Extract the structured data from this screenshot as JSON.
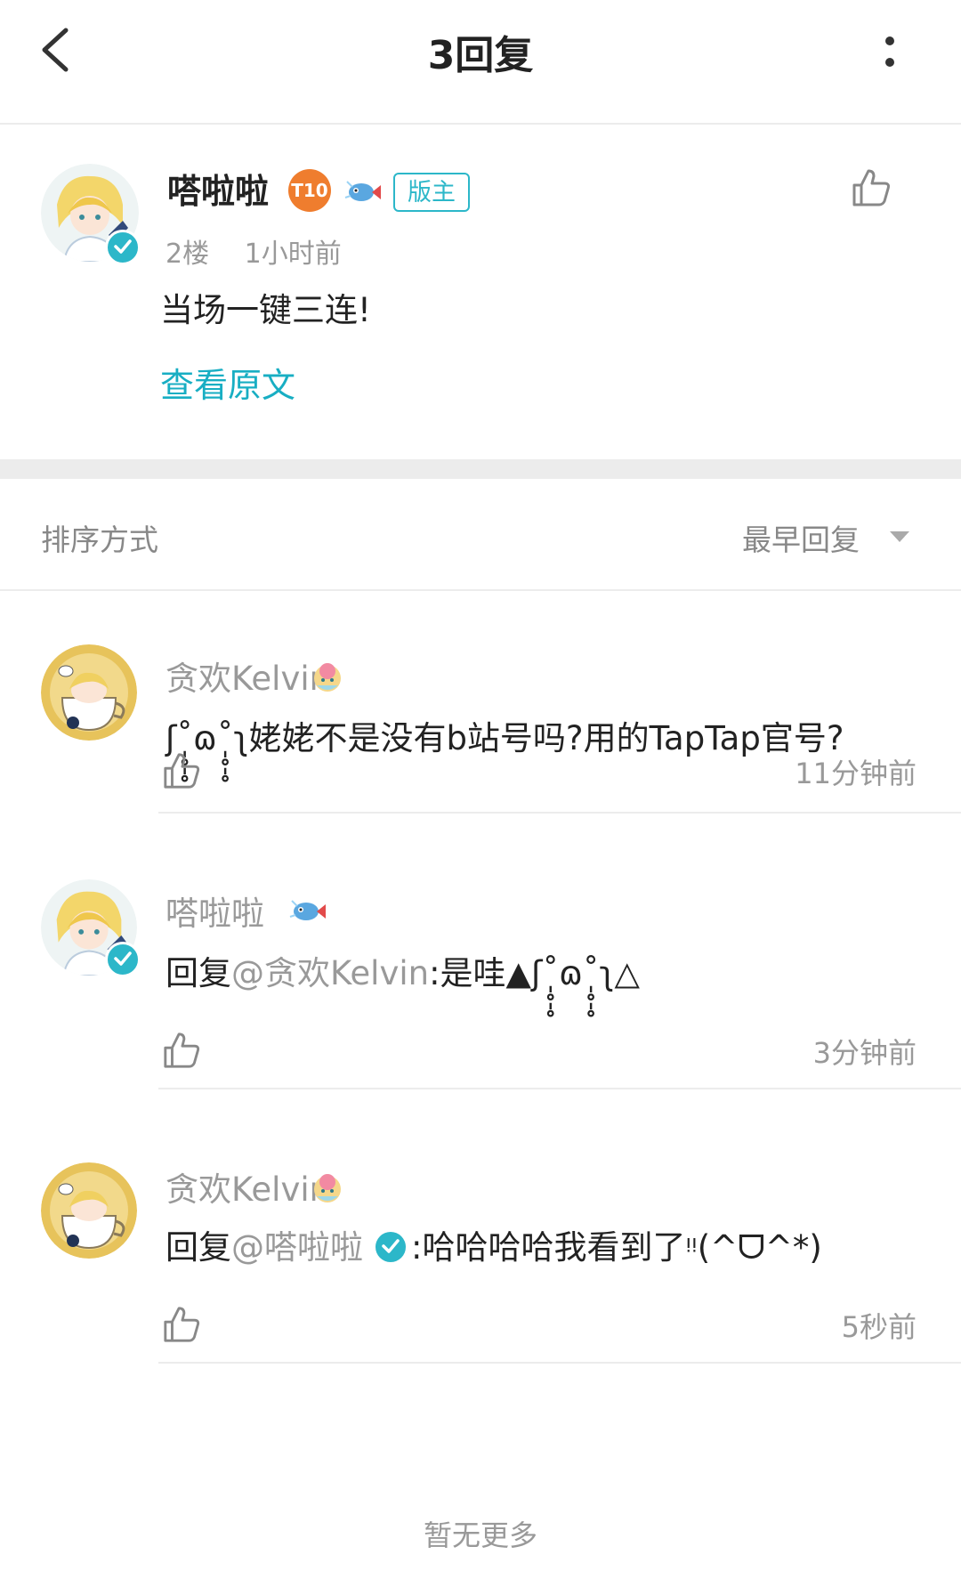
{
  "header": {
    "title": "3回复"
  },
  "original_post": {
    "username": "嗒啦啦",
    "level_badge": "T10",
    "role_badge": "版主",
    "floor": "2楼",
    "time": "1小时前",
    "content": "当场一键三连!",
    "view_original_link": "查看原文"
  },
  "sort": {
    "label": "排序方式",
    "value": "最早回复"
  },
  "replies": [
    {
      "username": "贪欢Kelvin",
      "content": "ʃ˚̩̥̩̥ɷ˚̩̥̩̥ʅ姥姥不是没有b站号吗?用的TapTap官号?",
      "time": "11分钟前"
    },
    {
      "username": "嗒啦啦",
      "reply_prefix": "回复",
      "mention": "@贪欢Kelvin",
      "content": ":是哇▲ʃ˚̩̥̩̥ɷ˚̩̥̩̥ʅ△",
      "time": "3分钟前"
    },
    {
      "username": "贪欢Kelvin",
      "reply_prefix": "回复",
      "mention": "@嗒啦啦",
      "content": ":哈哈哈哈我看到了ᵎᵎ(^ᗜ^*)",
      "time": "5秒前"
    }
  ],
  "footer": {
    "no_more": "暂无更多"
  },
  "colors": {
    "accent": "#2cb7c9",
    "link": "#18aec3",
    "muted": "#999999",
    "divider": "#ececec",
    "level_badge": "#ef7d2e"
  }
}
